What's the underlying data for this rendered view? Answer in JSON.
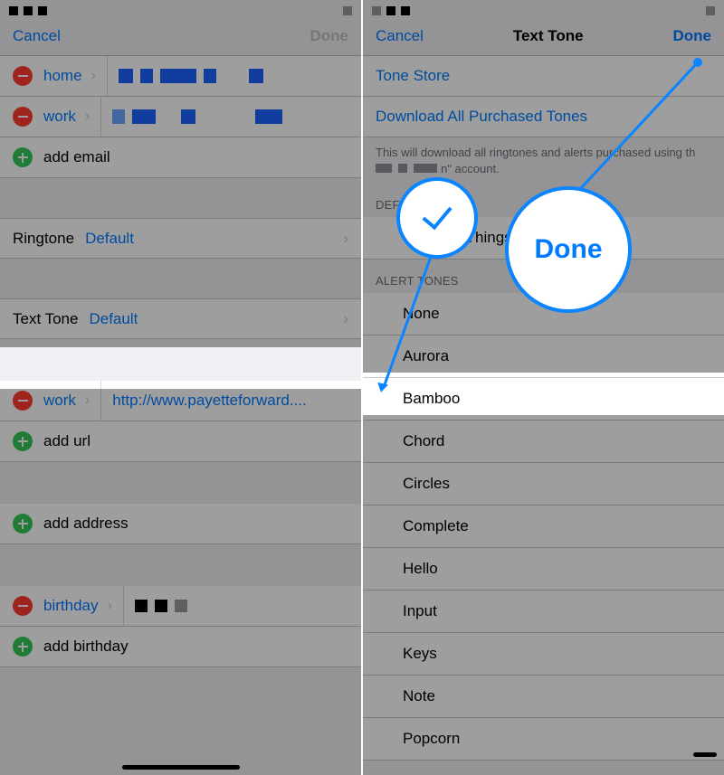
{
  "left": {
    "nav": {
      "cancel": "Cancel",
      "done": "Done"
    },
    "rows": {
      "home_label": "home",
      "work_label": "work",
      "add_email": "add email",
      "ringtone_label": "Ringtone",
      "ringtone_value": "Default",
      "texttone_label": "Text Tone",
      "texttone_value": "Default",
      "work2_label": "work",
      "work_url": "http://www.payetteforward....",
      "add_url": "add url",
      "add_address": "add address",
      "birthday_label": "birthday",
      "add_birthday": "add birthday"
    }
  },
  "right": {
    "nav": {
      "cancel": "Cancel",
      "title": "Text Tone",
      "done": "Done"
    },
    "links": {
      "tone_store": "Tone Store",
      "download": "Download All Purchased Tones"
    },
    "footer_a": "This will download all ringtones and alerts purchased using th",
    "footer_b": "n\" account.",
    "section_default": "DEFAULT",
    "default_item": "Stranger Things",
    "section_alert": "ALERT TONES",
    "tones": [
      "None",
      "Aurora",
      "Bamboo",
      "Chord",
      "Circles",
      "Complete",
      "Hello",
      "Input",
      "Keys",
      "Note",
      "Popcorn"
    ]
  },
  "callouts": {
    "done": "Done"
  }
}
